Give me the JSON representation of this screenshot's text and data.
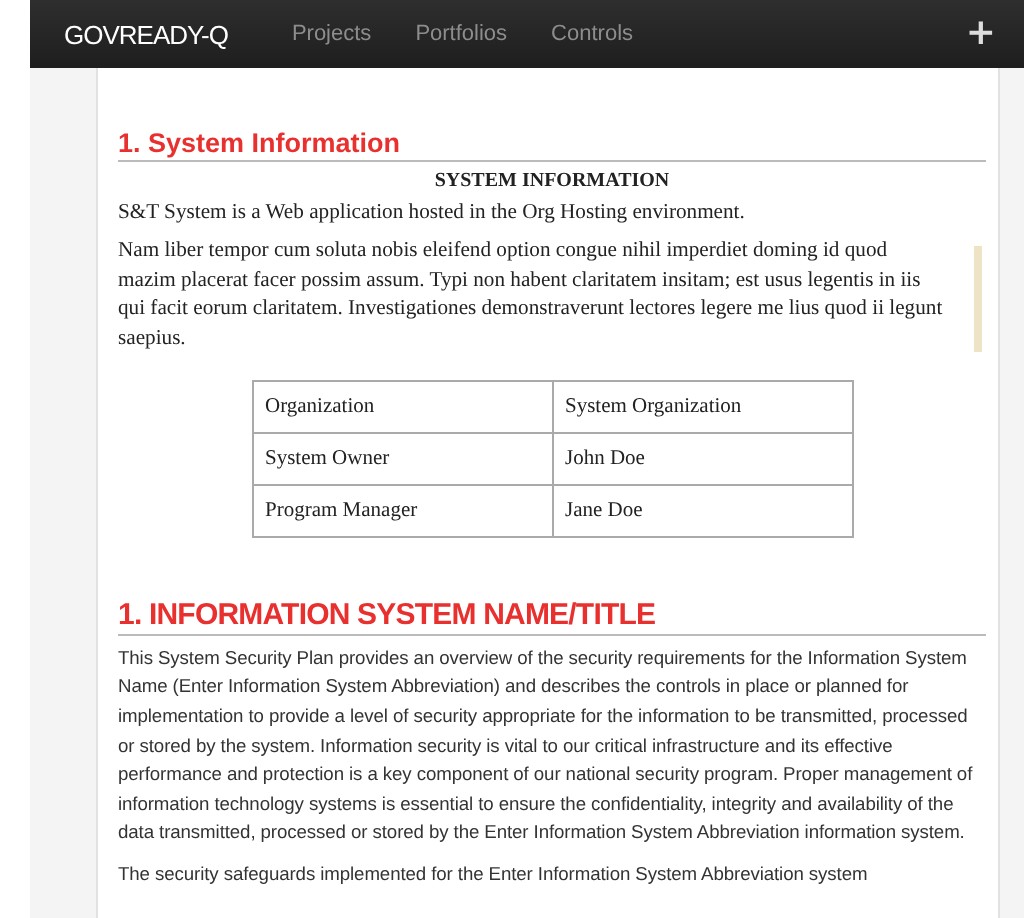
{
  "navbar": {
    "logo": "GOVREADY-Q",
    "links": [
      {
        "label": "Projects"
      },
      {
        "label": "Portfolios"
      },
      {
        "label": "Controls"
      }
    ],
    "add_button": "+"
  },
  "sections": [
    {
      "kind": "document",
      "heading": "1. System Information",
      "title": "SYSTEM INFORMATION",
      "paragraphs": [
        "S&T System is a Web application hosted in the Org Hosting environment.",
        "Nam liber tempor cum soluta nobis eleifend option congue nihil imperdiet doming id quod mazim placerat facer possim assum. Typi non habent claritatem insitam; est usus legentis in iis qui facit eorum claritatem. Investigationes demonstraverunt lectores legere me lius quod ii legunt saepius."
      ],
      "table": [
        [
          "Organization",
          "System Organization"
        ],
        [
          "System Owner",
          "John Doe"
        ],
        [
          "Program Manager",
          "Jane Doe"
        ]
      ]
    },
    {
      "kind": "plain",
      "heading": "1. INFORMATION SYSTEM NAME/TITLE",
      "paragraphs": [
        "This System Security Plan provides an overview of the security requirements for the Information System Name (Enter Information System Abbreviation) and describes the controls in place or planned for implementation to provide a level of security appropriate for the information to be transmitted, processed or stored by the system. Information security is vital to our critical infrastructure and its effective performance and protection is a key component of our national security program. Proper management of information technology systems is essential to ensure the confidentiality, integrity and availability of the data transmitted, processed or stored by the Enter Information System Abbreviation information system.",
        "The security safeguards implemented for the Enter Information System Abbreviation system"
      ]
    }
  ]
}
